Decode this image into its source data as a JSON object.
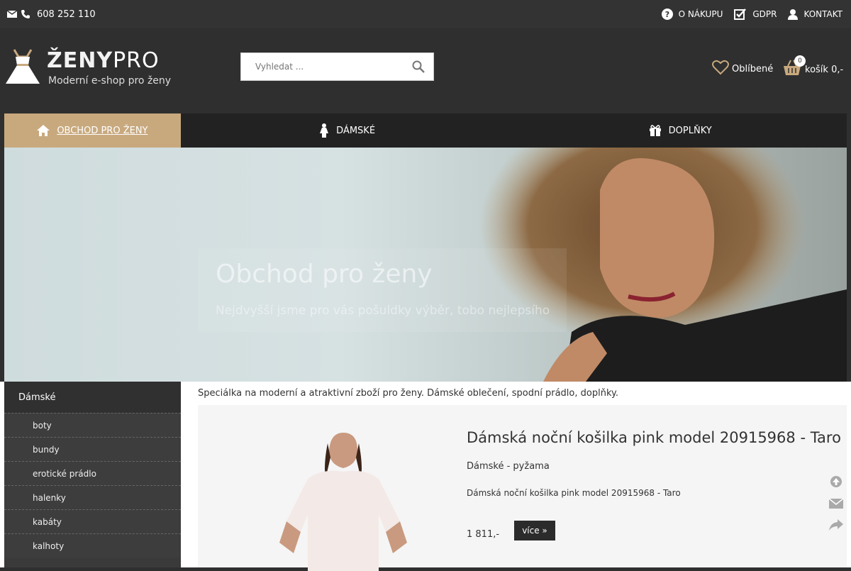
{
  "topbar": {
    "phone": "608 252 110",
    "links": [
      {
        "label": "O NÁKUPU",
        "icon": "question-circle-icon"
      },
      {
        "label": "GDPR",
        "icon": "check-square-icon"
      },
      {
        "label": "KONTAKT",
        "icon": "user-icon"
      }
    ]
  },
  "header": {
    "logo_main": "ŽENY",
    "logo_pro": "PRO",
    "logo_sub": "Moderní e-shop pro ženy",
    "search_placeholder": "Vyhledat ...",
    "favorites_label": "Oblíbené",
    "cart_label": "košík 0,-",
    "cart_count": "0"
  },
  "nav": {
    "items": [
      {
        "label": "OBCHOD PRO ŽENY",
        "icon": "home-icon"
      },
      {
        "label": "DÁMSKÉ",
        "icon": "woman-icon"
      },
      {
        "label": "DOPLŇKY",
        "icon": "gift-icon"
      }
    ]
  },
  "hero": {
    "title": "Obchod pro ženy",
    "subtitle": "Nejdvyšší jsme pro vás pošuldky výběr, tobo nejlepsího"
  },
  "sidebar": {
    "heading": "Dámské",
    "items": [
      "boty",
      "bundy",
      "erotické prádlo",
      "halenky",
      "kabáty",
      "kalhoty"
    ]
  },
  "main": {
    "intro": "Speciálka na moderní a atraktivní zboží pro ženy. Dámské oblečení, spodní prádlo, doplňky.",
    "product": {
      "title": "Dámská noční košilka pink model 20915968 - Taro",
      "category": "Dámské - pyžama",
      "description": "Dámská noční košilka pink model 20915968 - Taro",
      "price": "1 811,-",
      "more_label": "více »"
    }
  },
  "colors": {
    "accent": "#c8a97e",
    "dark": "#2f2f2f"
  }
}
